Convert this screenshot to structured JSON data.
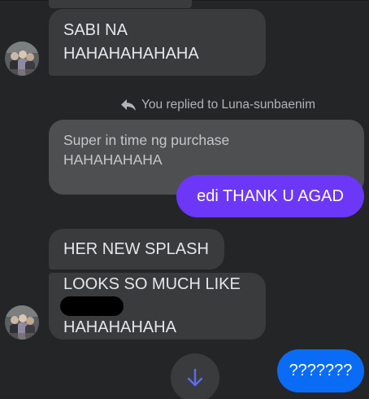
{
  "messages": [
    {
      "from": "contact",
      "lines": [
        "SABI NA",
        "HAHAHAHAHAHA"
      ],
      "show_avatar": true
    },
    {
      "from": "me",
      "reply_notice": "You replied to Luna-sunbaenim",
      "quoted_lines": [
        "Super in time ng purchase",
        "HAHAHAHAHA"
      ],
      "text": "edi THANK U AGAD",
      "bubble_color": "#6c37f6"
    },
    {
      "from": "contact",
      "lines": [
        "HER NEW SPLASH"
      ]
    },
    {
      "from": "contact",
      "lines": [
        "LOOKS SO MUCH LIKE",
        "HAHAHAHAHA"
      ],
      "redacted_prefix": true,
      "show_avatar": true
    },
    {
      "from": "me",
      "text": "???????",
      "bubble_color": "#0a6cf5"
    }
  ],
  "icons": {
    "reply": "reply-arrow-icon",
    "scroll_down": "arrow-down-icon"
  },
  "colors": {
    "background": "#242526",
    "incoming_bubble": "#3a3b3c",
    "quoted_bubble": "#4e4f50",
    "text_primary": "#e4e6eb",
    "text_secondary": "#b0b3b8",
    "scroll_arrow": "#5b6cf0"
  }
}
